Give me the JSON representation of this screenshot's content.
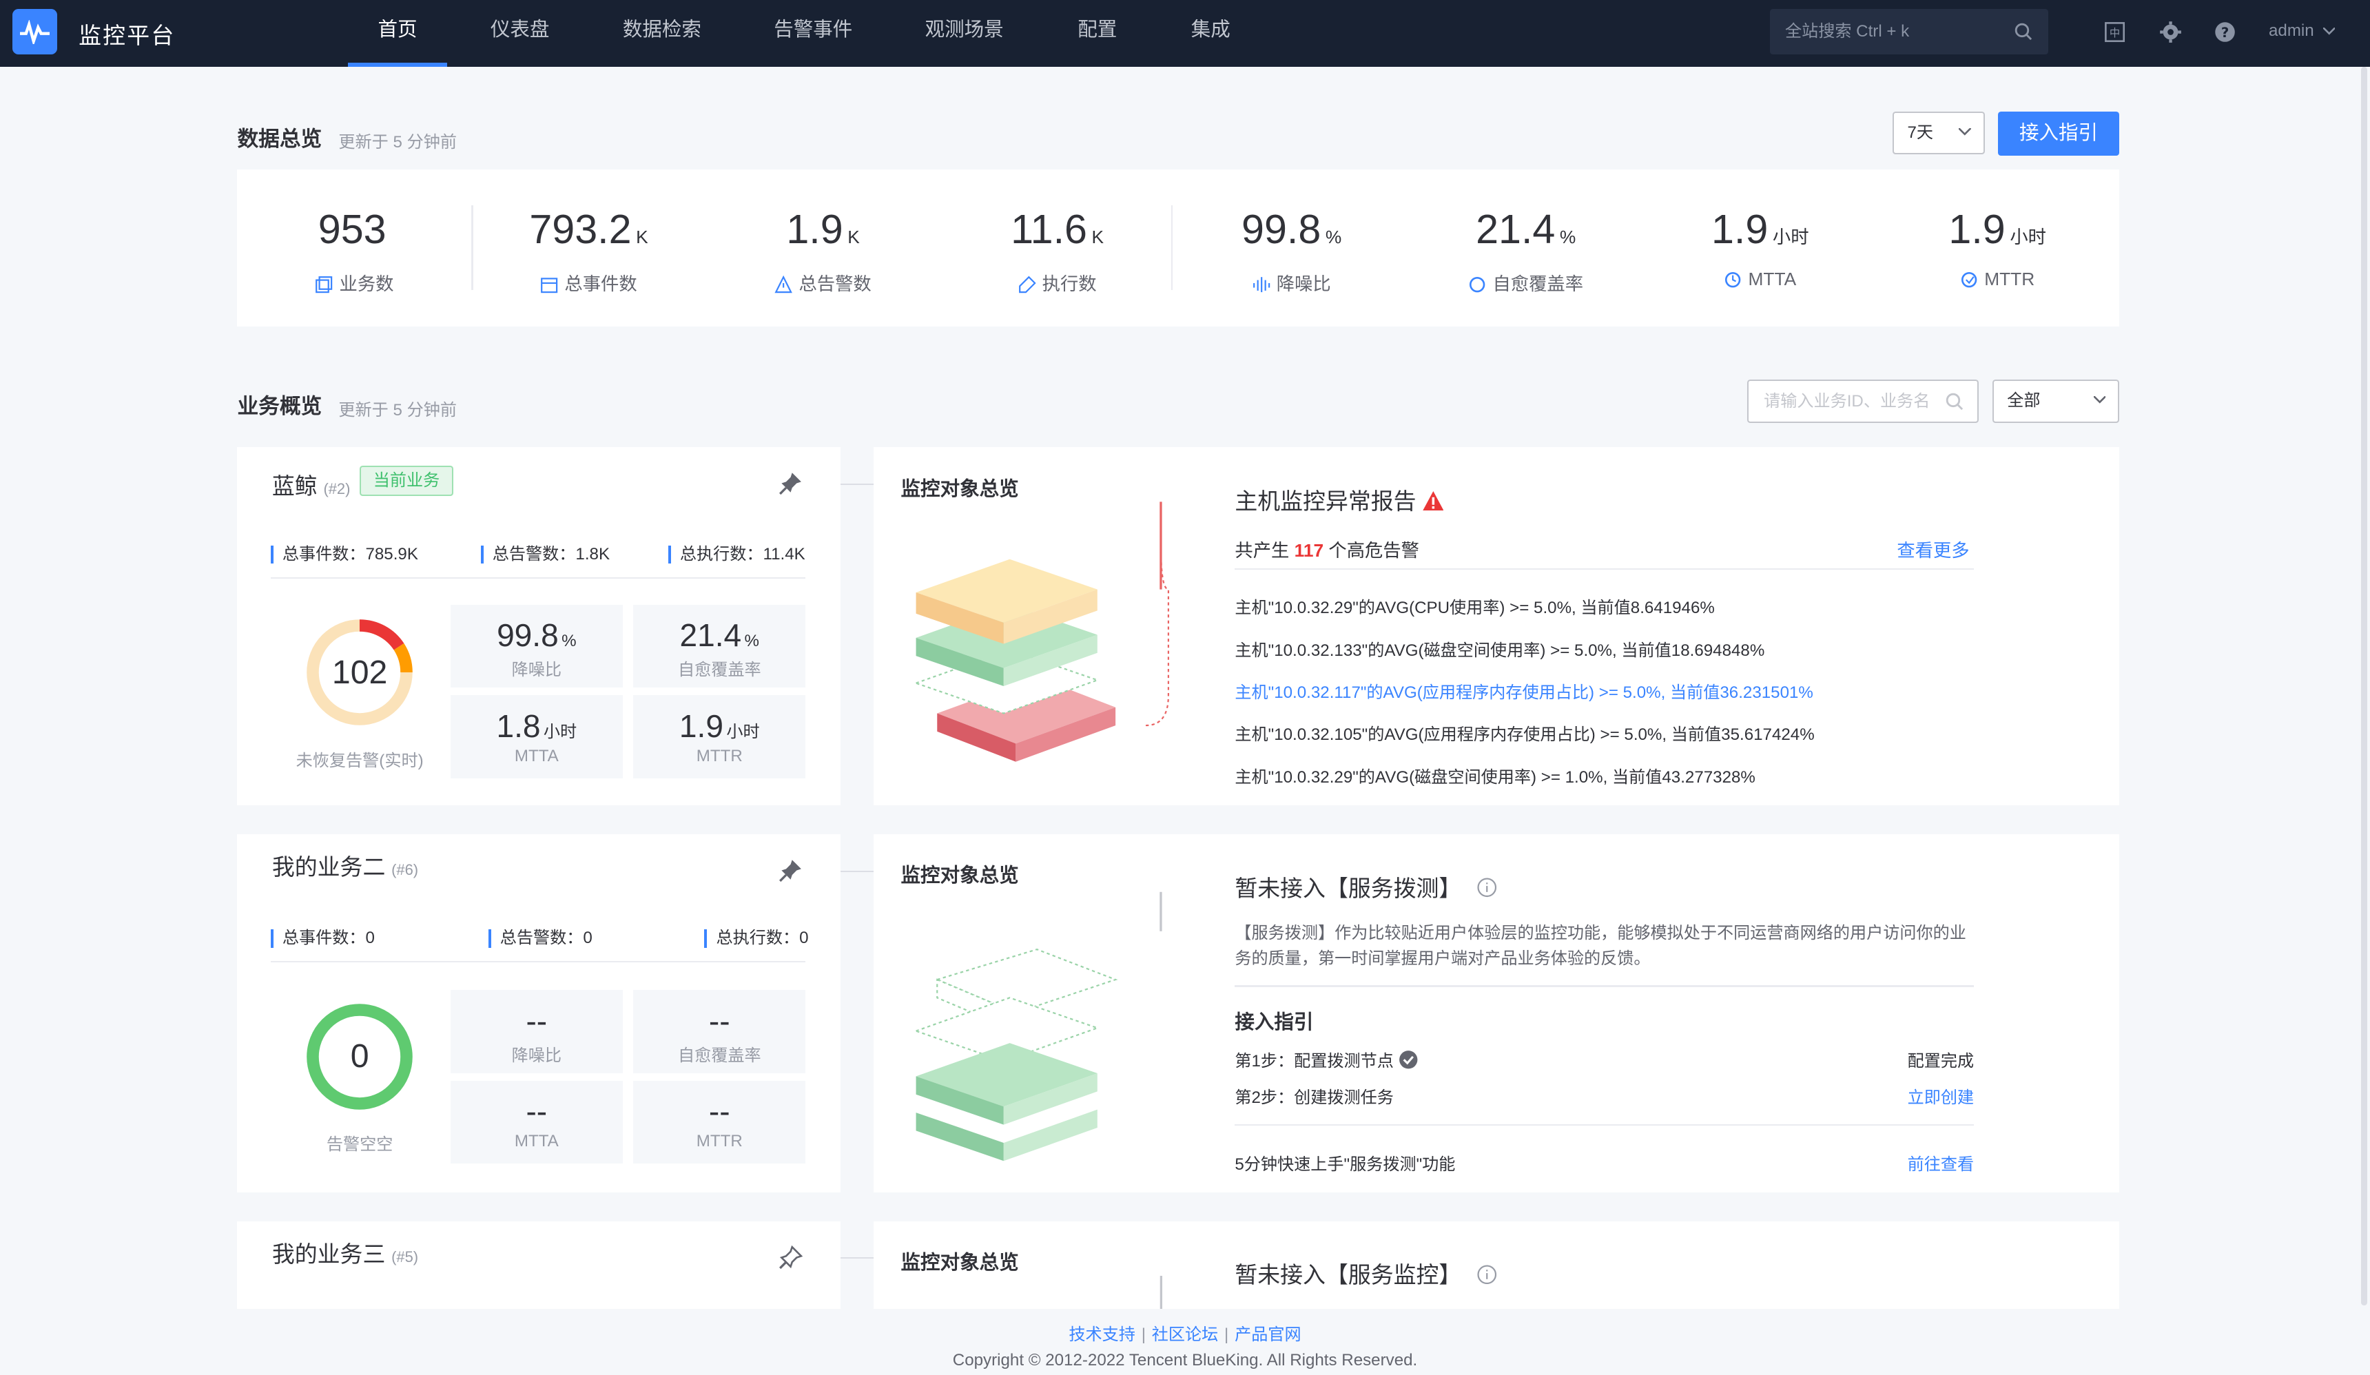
{
  "nav": {
    "brand": "监控平台",
    "items": [
      {
        "label": "首页",
        "active": true
      },
      {
        "label": "仪表盘"
      },
      {
        "label": "数据检索"
      },
      {
        "label": "告警事件"
      },
      {
        "label": "观测场景"
      },
      {
        "label": "配置"
      },
      {
        "label": "集成"
      }
    ],
    "search_placeholder": "全站搜索 Ctrl + k",
    "user": "admin"
  },
  "overview": {
    "title": "数据总览",
    "subtitle": "更新于 5 分钟前",
    "range": "7天",
    "guide_button": "接入指引",
    "stats": [
      {
        "value": "953",
        "unit": "",
        "label": "业务数",
        "icon": "business-icon"
      },
      {
        "value": "793.2",
        "unit": "K",
        "label": "总事件数",
        "icon": "calendar-icon"
      },
      {
        "value": "1.9",
        "unit": "K",
        "label": "总告警数",
        "icon": "warning-icon"
      },
      {
        "value": "11.6",
        "unit": "K",
        "label": "执行数",
        "icon": "execute-icon"
      },
      {
        "value": "99.8",
        "unit": "%",
        "label": "降噪比",
        "icon": "noise-icon"
      },
      {
        "value": "21.4",
        "unit": "%",
        "label": "自愈覆盖率",
        "icon": "heal-icon"
      },
      {
        "value": "1.9",
        "unit": "小时",
        "label": "MTTA",
        "icon": "mtta-icon"
      },
      {
        "value": "1.9",
        "unit": "小时",
        "label": "MTTR",
        "icon": "mttr-icon"
      }
    ]
  },
  "business": {
    "title": "业务概览",
    "subtitle": "更新于 5 分钟前",
    "search_placeholder": "请输入业务ID、业务名",
    "filter": "全部",
    "cards": [
      {
        "name": "蓝鲸",
        "id": "(#2)",
        "tag": "当前业务",
        "counts": [
          "总事件数：785.9K",
          "总告警数：1.8K",
          "总执行数：11.4K"
        ],
        "ring_value": "102",
        "ring_label": "未恢复告警(实时)",
        "metrics": [
          {
            "value": "99.8",
            "unit": "%",
            "label": "降噪比"
          },
          {
            "value": "21.4",
            "unit": "%",
            "label": "自愈覆盖率"
          },
          {
            "value": "1.8",
            "unit": "小时",
            "label": "MTTA"
          },
          {
            "value": "1.9",
            "unit": "小时",
            "label": "MTTR"
          }
        ],
        "overview_title": "监控对象总览",
        "report": {
          "title": "主机监控异常报告",
          "summary_prefix": "共产生",
          "summary_count": "117",
          "summary_suffix": "个高危告警",
          "more": "查看更多",
          "alerts": [
            "主机\"10.0.32.29\"的AVG(CPU使用率) >= 5.0%, 当前值8.641946%",
            "主机\"10.0.32.133\"的AVG(磁盘空间使用率) >= 5.0%, 当前值18.694848%",
            "主机\"10.0.32.117\"的AVG(应用程序内存使用占比) >= 5.0%, 当前值36.231501%",
            "主机\"10.0.32.105\"的AVG(应用程序内存使用占比) >= 5.0%, 当前值35.617424%",
            "主机\"10.0.32.29\"的AVG(磁盘空间使用率) >= 1.0%, 当前值43.277328%"
          ]
        }
      },
      {
        "name": "我的业务二",
        "id": "(#6)",
        "counts": [
          "总事件数：0",
          "总告警数：0",
          "总执行数：0"
        ],
        "ring_value": "0",
        "ring_label": "告警空空",
        "metrics": [
          {
            "value": "--",
            "label": "降噪比"
          },
          {
            "value": "--",
            "label": "自愈覆盖率"
          },
          {
            "value": "--",
            "label": "MTTA"
          },
          {
            "value": "--",
            "label": "MTTR"
          }
        ],
        "overview_title": "监控对象总览",
        "guide": {
          "title": "暂未接入【服务拨测】",
          "desc": "【服务拨测】作为比较贴近用户体验层的监控功能，能够模拟处于不同运营商网络的用户访问你的业务的质量，第一时间掌握用户端对产品业务体验的反馈。",
          "guide_title": "接入指引",
          "step1": "第1步：配置拨测节点",
          "step1_status": "配置完成",
          "step2": "第2步：创建拨测任务",
          "step2_action": "立即创建",
          "quick": "5分钟快速上手\"服务拨测\"功能",
          "quick_action": "前往查看"
        }
      },
      {
        "name": "我的业务三",
        "id": "(#5)",
        "overview_title": "监控对象总览",
        "guide_title": "暂未接入【服务监控】"
      }
    ]
  },
  "footer": {
    "links": [
      "技术支持",
      "社区论坛",
      "产品官网"
    ],
    "copyright": "Copyright © 2012-2022 Tencent BlueKing. All Rights Reserved."
  },
  "colors": {
    "primary": "#3a84ff",
    "nav_bg": "#182132",
    "danger": "#ea3636",
    "success": "#2dcb56",
    "warning": "#ff9c01"
  }
}
